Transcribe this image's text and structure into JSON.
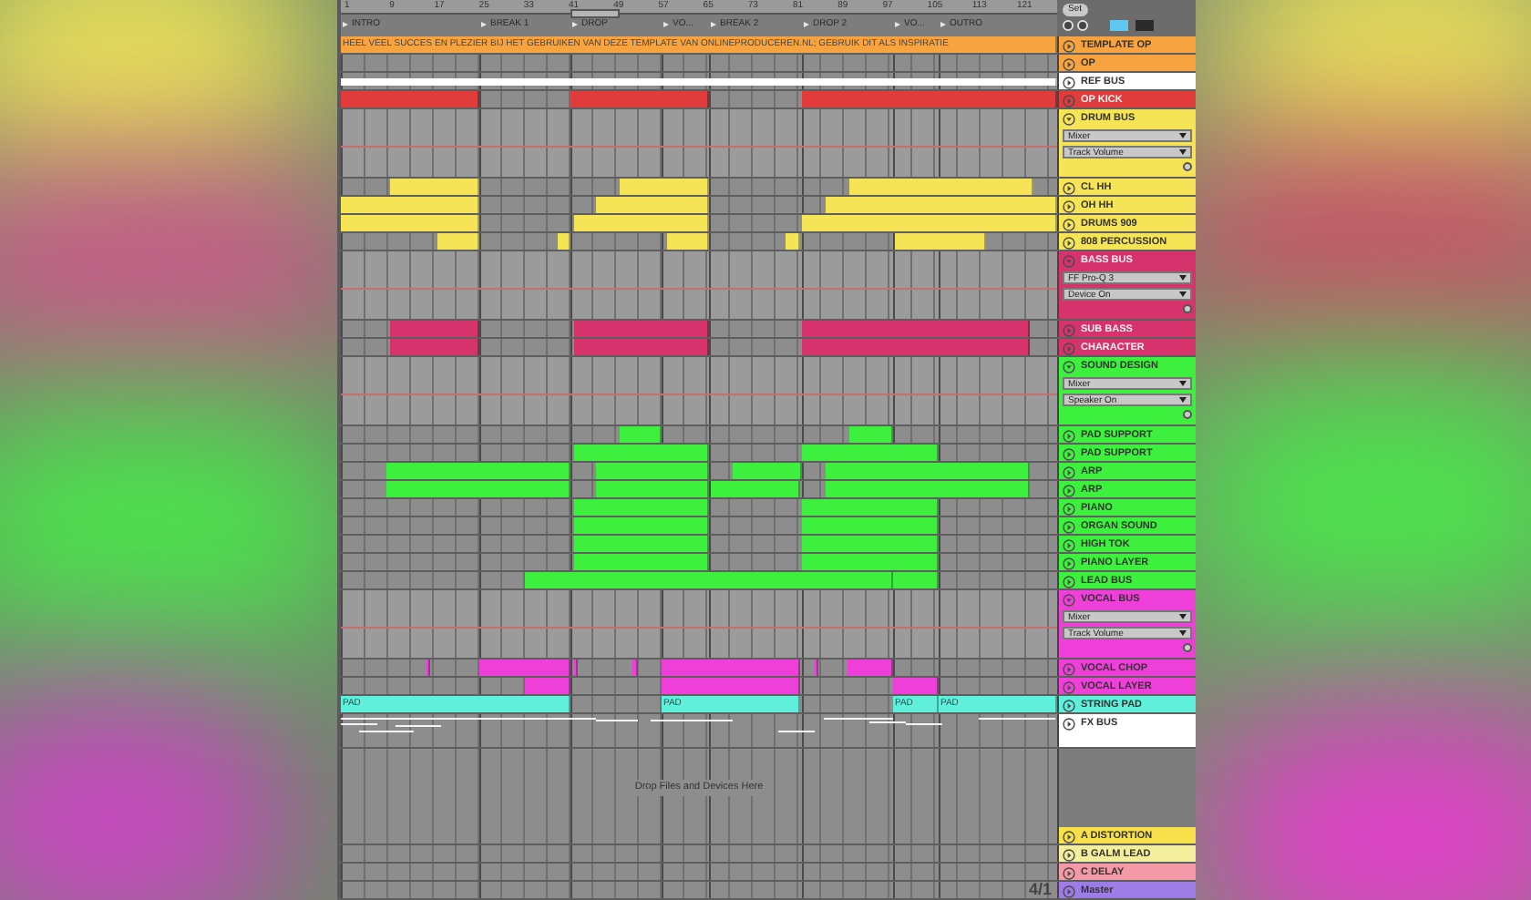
{
  "ruler": {
    "bars": [
      "1",
      "9",
      "17",
      "25",
      "33",
      "41",
      "49",
      "57",
      "65",
      "73",
      "81",
      "89",
      "97",
      "105",
      "113",
      "121"
    ]
  },
  "locators": [
    {
      "label": "INTRO"
    },
    {
      "label": "BREAK 1"
    },
    {
      "label": "DROP"
    },
    {
      "label": "VO..."
    },
    {
      "label": "BREAK 2"
    },
    {
      "label": "DROP 2"
    },
    {
      "label": "VO..."
    },
    {
      "label": "OUTRO"
    }
  ],
  "set_button": "Set",
  "tracks": [
    {
      "name": "TEMPLATE OP",
      "color": "#f7a440",
      "kind": "track",
      "clips": [
        {
          "label": "HEEL VEEL SUCCES EN PLEZIER BIJ HET GEBRUIKEN VAN DEZE TEMPLATE VAN ONLINEPRODUCEREN.NL; GEBRUIK DIT ALS INSPIRATIE"
        }
      ]
    },
    {
      "name": "OP",
      "color": "#f7a440",
      "kind": "track"
    },
    {
      "name": "REF BUS",
      "color": "#ffffff",
      "kind": "track"
    },
    {
      "name": "OP KICK",
      "color": "#e23b3b",
      "kind": "track"
    },
    {
      "name": "DRUM BUS",
      "color": "#f5e456",
      "kind": "group",
      "expanded": true,
      "choosers": [
        "Mixer",
        "Track Volume"
      ]
    },
    {
      "name": "CL HH",
      "color": "#f5e456",
      "kind": "track"
    },
    {
      "name": "OH HH",
      "color": "#f5e456",
      "kind": "track"
    },
    {
      "name": "DRUMS 909",
      "color": "#f5e456",
      "kind": "track"
    },
    {
      "name": "808 PERCUSSION",
      "color": "#f5e456",
      "kind": "track"
    },
    {
      "name": "BASS BUS",
      "color": "#d6336c",
      "kind": "group",
      "expanded": true,
      "choosers": [
        "FF Pro-Q 3",
        "Device On"
      ]
    },
    {
      "name": "SUB BASS",
      "color": "#d6336c",
      "kind": "track"
    },
    {
      "name": "CHARACTER",
      "color": "#d6336c",
      "kind": "track"
    },
    {
      "name": "SOUND DESIGN",
      "color": "#3ef03e",
      "kind": "group",
      "expanded": true,
      "choosers": [
        "Mixer",
        "Speaker On"
      ]
    },
    {
      "name": "PAD SUPPORT",
      "color": "#3ef03e",
      "kind": "track"
    },
    {
      "name": "PAD SUPPORT",
      "color": "#3ef03e",
      "kind": "track"
    },
    {
      "name": "ARP",
      "color": "#3ef03e",
      "kind": "track"
    },
    {
      "name": "ARP",
      "color": "#3ef03e",
      "kind": "track"
    },
    {
      "name": "PIANO",
      "color": "#3ef03e",
      "kind": "track"
    },
    {
      "name": "ORGAN SOUND",
      "color": "#3ef03e",
      "kind": "track"
    },
    {
      "name": "HIGH TOK",
      "color": "#3ef03e",
      "kind": "track"
    },
    {
      "name": "PIANO LAYER",
      "color": "#3ef03e",
      "kind": "track"
    },
    {
      "name": "LEAD BUS",
      "color": "#3ef03e",
      "kind": "track"
    },
    {
      "name": "VOCAL BUS",
      "color": "#ee3fd8",
      "kind": "group",
      "expanded": true,
      "choosers": [
        "Mixer",
        "Track Volume"
      ]
    },
    {
      "name": "VOCAL CHOP",
      "color": "#ee3fd8",
      "kind": "track"
    },
    {
      "name": "VOCAL LAYER",
      "color": "#ee3fd8",
      "kind": "track"
    },
    {
      "name": "STRING PAD",
      "color": "#5ff0dc",
      "kind": "track",
      "clips": [
        {
          "label": "PAD"
        },
        {
          "label": "PAD"
        },
        {
          "label": "PAD"
        },
        {
          "label": "PAD"
        }
      ]
    },
    {
      "name": "FX BUS",
      "color": "#ffffff",
      "kind": "midi"
    }
  ],
  "drop_hint": "Drop Files and Devices Here",
  "returns": [
    {
      "name": "A DISTORTION",
      "color": "#f7e04a"
    },
    {
      "name": "B GALM LEAD",
      "color": "#f4ef9c"
    },
    {
      "name": "C DELAY",
      "color": "#f49aa6"
    },
    {
      "name": "Master",
      "color": "#9d7ce6"
    }
  ],
  "zoom_readout": "4/1"
}
